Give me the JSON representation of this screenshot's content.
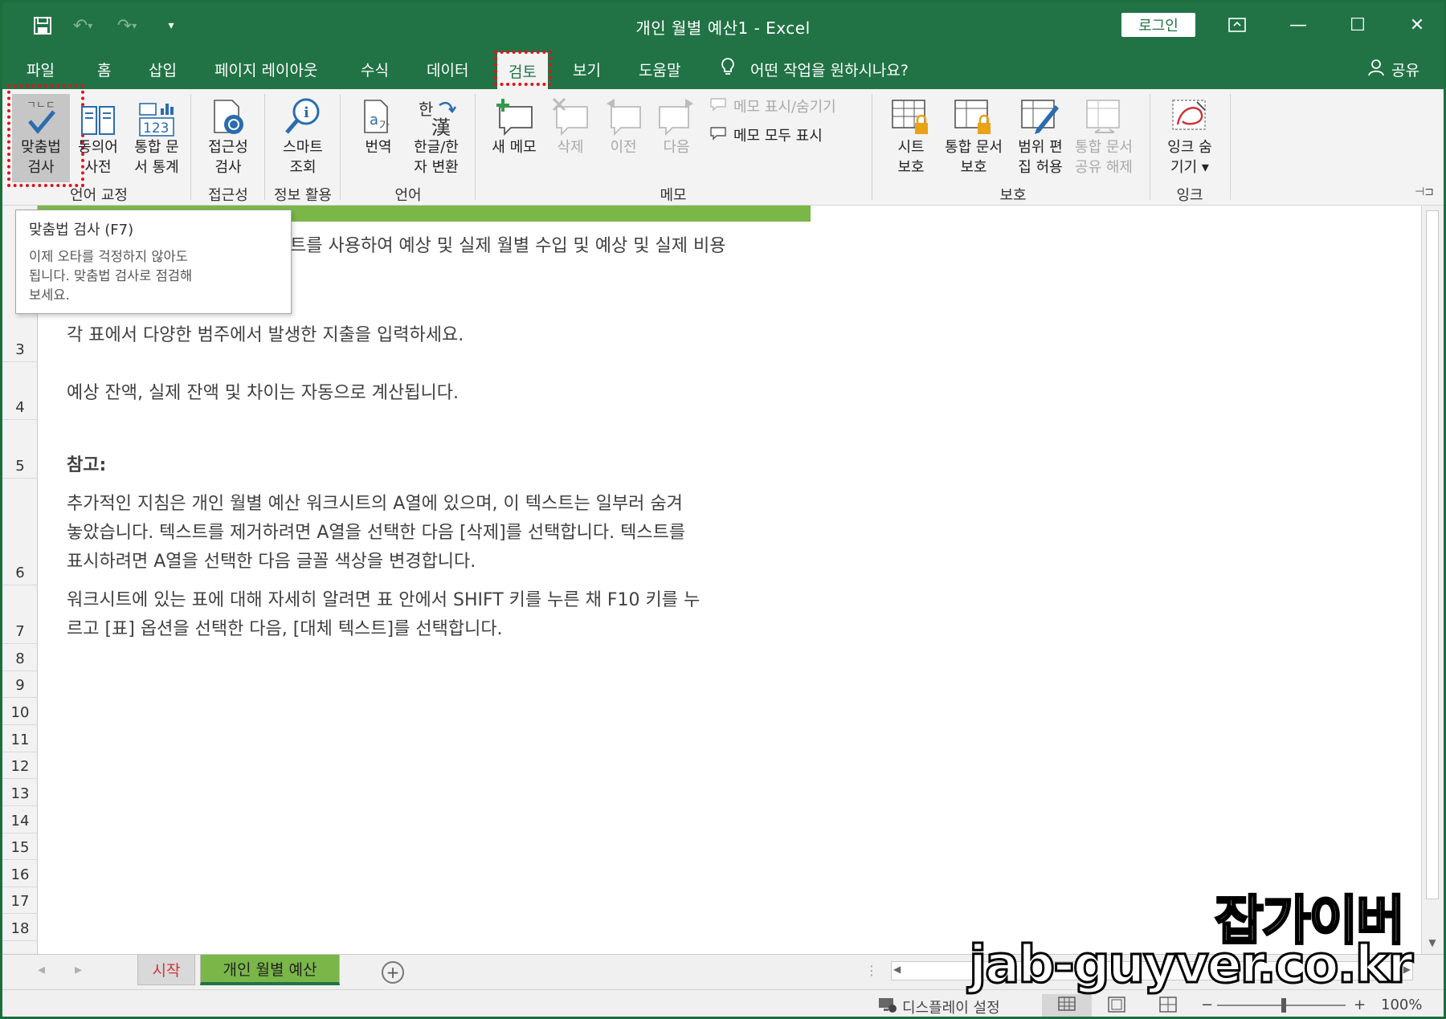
{
  "window": {
    "title": "개인 월별 예산1  -  Excel",
    "login_label": "로그인",
    "controls": [
      "ribbon-display-icon",
      "minimize-icon",
      "maximize-icon",
      "close-icon"
    ]
  },
  "quick_access": [
    "save-icon",
    "undo-icon",
    "redo-icon",
    "customize-icon"
  ],
  "tabs": [
    "파일",
    "홈",
    "삽입",
    "페이지 레이아웃",
    "수식",
    "데이터",
    "검토",
    "보기",
    "도움말"
  ],
  "active_tab": "검토",
  "tell_me": "어떤 작업을 원하시나요?",
  "share_label": "공유",
  "ribbon": {
    "proofing": {
      "label": "언어 교정",
      "spelling": [
        "맞춤법",
        "검사"
      ],
      "thesaurus": [
        "동의어",
        "사전"
      ],
      "workbook_stats": [
        "통합 문",
        "서 통계"
      ]
    },
    "accessibility": {
      "label": "접근성",
      "check": [
        "접근성",
        "검사"
      ]
    },
    "insights": {
      "label": "정보 활용",
      "smart_lookup": [
        "스마트",
        "조회"
      ]
    },
    "language": {
      "label": "언어",
      "translate": [
        "번역"
      ],
      "hangul_hanja": [
        "한글/한",
        "자 변환"
      ]
    },
    "comments": {
      "label": "메모",
      "new": [
        "새 메모"
      ],
      "delete": [
        "삭제"
      ],
      "previous": [
        "이전"
      ],
      "next": [
        "다음"
      ],
      "show_hide": "메모 표시/숨기기",
      "show_all": "메모 모두 표시"
    },
    "protect": {
      "label": "보호",
      "sheet": [
        "시트",
        "보호"
      ],
      "workbook": [
        "통합 문서",
        "보호"
      ],
      "allow_edit": [
        "범위 편",
        "집 허용"
      ],
      "unshare": [
        "통합 문서",
        "공유 해제"
      ]
    },
    "ink": {
      "label": "잉크",
      "hide_ink": [
        "잉크 숨",
        "기기 ▾"
      ]
    }
  },
  "tooltip": {
    "title": "맞춤법 검사 (F7)",
    "body": [
      "이제 오타를 걱정하지 않아도",
      "됩니다. 맞춤법 검사로 점검해",
      "보세요."
    ]
  },
  "rows": [
    "3",
    "4",
    "5",
    "6",
    "7",
    "8",
    "9",
    "10",
    "11",
    "12",
    "13",
    "14",
    "15",
    "16",
    "17",
    "18"
  ],
  "content": {
    "line1": "트를 사용하여 예상 및 실제 월별 수입 및 예상 및 실제 비용",
    "line_r3": "각 표에서 다양한 범주에서 발생한 지출을 입력하세요.",
    "line_r4": "예상 잔액, 실제 잔액 및 차이는 자동으로 계산됩니다.",
    "note_heading": "참고:",
    "note_p1": [
      "추가적인 지침은 개인 월별 예산 워크시트의 A열에 있으며, 이 텍스트는 일부러 숨겨",
      "놓았습니다. 텍스트를 제거하려면 A열을 선택한 다음 [삭제]를 선택합니다. 텍스트를",
      "표시하려면 A열을 선택한 다음 글꼴 색상을 변경합니다."
    ],
    "note_p2": [
      "워크시트에 있는 표에 대해 자세히 알려면 표 안에서 SHIFT 키를 누른 채 F10 키를 누",
      "르고 [표] 옵션을 선택한 다음, [대체 텍스트]를 선택합니다."
    ]
  },
  "sheet_tabs": [
    "시작",
    "개인 월별 예산"
  ],
  "active_sheet": "개인 월별 예산",
  "status": {
    "display_settings": "디스플레이 설정",
    "zoom": "100%"
  },
  "watermark": {
    "line1": "잡가이버",
    "line2": "jab-guyver.co.kr"
  },
  "colors": {
    "excel_green": "#217346",
    "accent_green": "#7ab648",
    "highlight_red": "#e0141b"
  }
}
